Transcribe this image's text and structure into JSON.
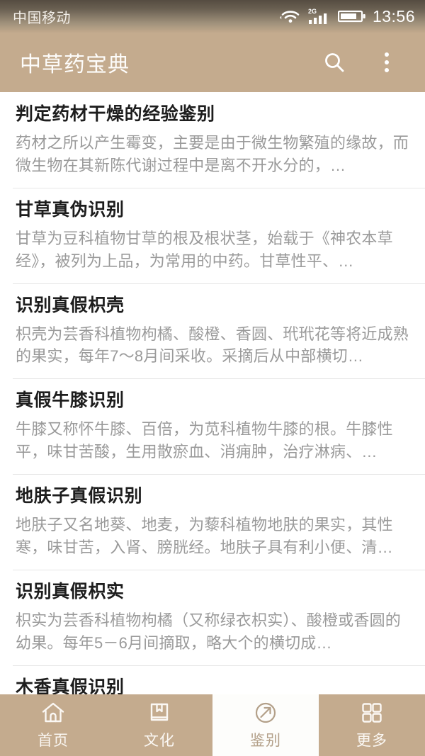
{
  "status_bar": {
    "carrier": "中国移动",
    "time": "13:56",
    "network_type": "2G",
    "icons": [
      "wifi-icon",
      "cellular-signal-icon",
      "battery-icon"
    ]
  },
  "app_bar": {
    "title": "中草药宝典",
    "search_icon": "search-icon",
    "overflow_icon": "overflow-menu-icon"
  },
  "colors": {
    "brand_tan": "#c4ab8e",
    "active_tab_bg": "#fdfdfb",
    "active_tab_fg": "#b3a089",
    "title_text": "#1d1d1d",
    "body_text": "#9a9a9a",
    "divider": "#e6e6e6"
  },
  "list": {
    "items": [
      {
        "title": "判定药材干燥的经验鉴别",
        "desc": "药材之所以产生霉变，主要是由于微生物繁殖的缘故，而微生物在其新陈代谢过程中是离不开水分的，…"
      },
      {
        "title": "甘草真伪识别",
        "desc": "甘草为豆科植物甘草的根及根状茎，始载于《神农本草经》，被列为上品，为常用的中药。甘草性平、…"
      },
      {
        "title": "识别真假枳壳",
        "desc": "枳壳为芸香科植物枸橘、酸橙、香圆、玳玳花等将近成熟的果实，每年7～8月间采收。采摘后从中部横切…"
      },
      {
        "title": "真假牛膝识别",
        "desc": "牛膝又称怀牛膝、百倍，为苋科植物牛膝的根。牛膝性平，味甘苦酸，生用散瘀血、消痈肿，治疗淋病、…"
      },
      {
        "title": "地肤子真假识别",
        "desc": "地肤子又名地葵、地麦，为藜科植物地肤的果实，其性寒，味甘苦，入肾、膀胱经。地肤子具有利小便、清…"
      },
      {
        "title": "识别真假枳实",
        "desc": "枳实为芸香科植物枸橘（又称绿衣枳实）、酸橙或香圆的幼果。每年5－6月间摘取，略大个的横切成…"
      },
      {
        "title": "木香真假识别",
        "desc": ""
      }
    ]
  },
  "bottom_nav": {
    "items": [
      {
        "label": "首页",
        "icon": "home-icon",
        "active": false
      },
      {
        "label": "文化",
        "icon": "book-icon",
        "active": false
      },
      {
        "label": "鉴别",
        "icon": "compass-arrow-icon",
        "active": true
      },
      {
        "label": "更多",
        "icon": "grid-icon",
        "active": false
      }
    ]
  }
}
